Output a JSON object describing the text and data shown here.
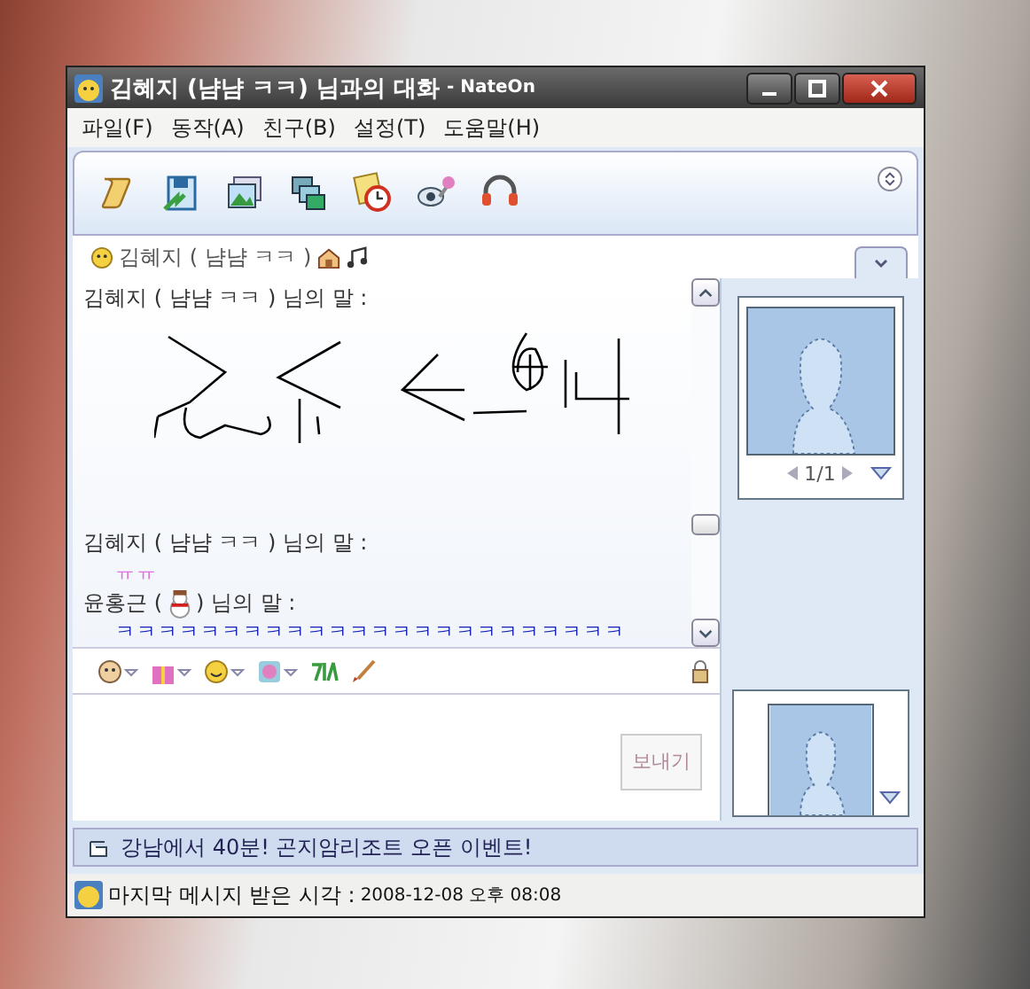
{
  "window": {
    "title": "김혜지 (냠냠 ㅋㅋ) 님과의 대화",
    "app_name": "- NateOn"
  },
  "menu": [
    "파일(F)",
    "동작(A)",
    "친구(B)",
    "설정(T)",
    "도움말(H)"
  ],
  "contact": {
    "name": "김혜지 ( 냠냠 ㅋㅋ )"
  },
  "messages": [
    {
      "kind": "drawing",
      "sender": "김혜지 ( 냠냠 ㅋㅋ ) 님의 말 :"
    },
    {
      "kind": "text",
      "sender": "김혜지 ( 냠냠 ㅋㅋ ) 님의 말 :",
      "text": "ㅠㅠ",
      "color": "#e070e0"
    },
    {
      "kind": "text",
      "sender": "윤홍근 (",
      "sender_end": ") 님의 말 :",
      "text": "ㅋㅋㅋㅋㅋㅋㅋㅋㅋㅋㅋㅋㅋㅋㅋㅋㅋㅋㅋㅋㅋㅋㅋㅋ",
      "color": "#1020b0"
    }
  ],
  "avatar_pager": "1/1",
  "send_button": {
    "label": "보내기",
    "disabled": true
  },
  "ad_text": "강남에서 40분! 곤지암리조트 오픈 이벤트!",
  "status_bar": {
    "label": "마지막 메시지 받은 시각 :",
    "time": "2008-12-08 오후 08:08"
  }
}
